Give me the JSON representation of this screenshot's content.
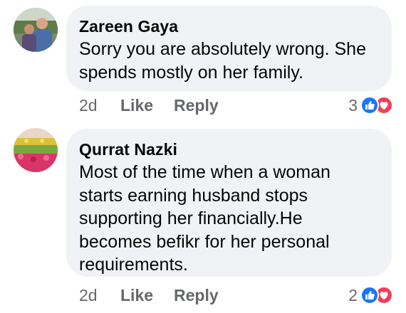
{
  "comments": [
    {
      "author": "Zareen Gaya",
      "text": "Sorry you are absolutely wrong.  She\nspends mostly on her family.",
      "time": "2d",
      "like_label": "Like",
      "reply_label": "Reply",
      "reaction_count": "3"
    },
    {
      "author": "Qurrat Nazki",
      "text": "Most of the time when a woman\nstarts earning husband stops\nsupporting her financially.He\nbecomes befikr for her personal\nrequirements.",
      "time": "2d",
      "like_label": "Like",
      "reply_label": "Reply",
      "reaction_count": "2"
    }
  ],
  "colors": {
    "bubble": "#f0f2f5",
    "secondary_text": "#65676b",
    "like_reaction": "#1877f2",
    "love_reaction": "#f33e58"
  },
  "icons": [
    "like-reaction-icon",
    "love-reaction-icon"
  ]
}
